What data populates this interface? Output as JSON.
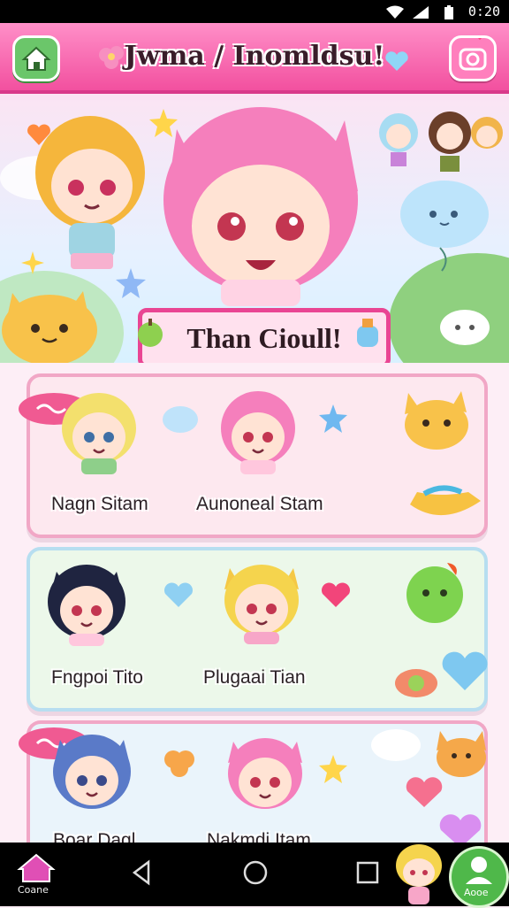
{
  "status": {
    "time": "0:20"
  },
  "header": {
    "title": "Jwma / Inomldsu!"
  },
  "hero": {
    "banner_text": "Than Cioull!"
  },
  "cards": [
    {
      "left_name": "Nagn Sitam",
      "right_name": "Aunoneal Stam"
    },
    {
      "left_name": "Fngpoi Tito",
      "right_name": "Plugaai Tian"
    },
    {
      "left_name": "Boar Dagl",
      "right_name": "Nakmdi Itam"
    }
  ],
  "navbar": {
    "left_label": "Coane",
    "right_label": "Aooe"
  },
  "colors": {
    "accent": "#f2509f",
    "green": "#6bc66a"
  }
}
